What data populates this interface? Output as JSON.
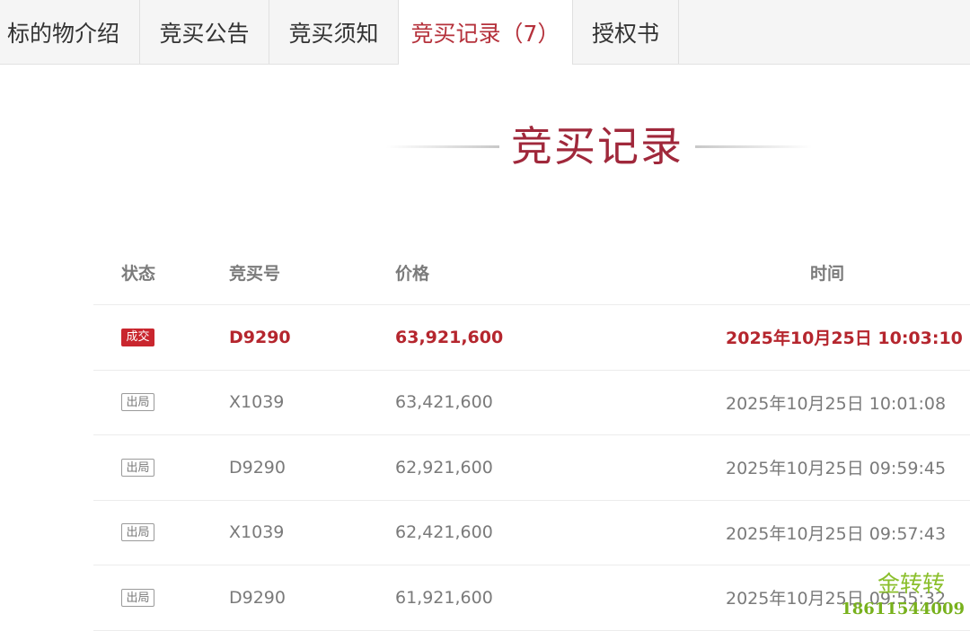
{
  "tabs": [
    {
      "label": "标的物介绍",
      "active": false
    },
    {
      "label": "竞买公告",
      "active": false
    },
    {
      "label": "竞买须知",
      "active": false
    },
    {
      "label": "竞买记录（7）",
      "active": true
    },
    {
      "label": "授权书",
      "active": false
    }
  ],
  "section": {
    "title": "竞买记录"
  },
  "table": {
    "headers": {
      "status": "状态",
      "bid_no": "竞买号",
      "price": "价格",
      "time": "时间"
    },
    "rows": [
      {
        "status": "成交",
        "bid_no": "D9290",
        "price": "63,921,600",
        "time": "2025年10月25日 10:03:10"
      },
      {
        "status": "出局",
        "bid_no": "X1039",
        "price": "63,421,600",
        "time": "2025年10月25日 10:01:08"
      },
      {
        "status": "出局",
        "bid_no": "D9290",
        "price": "62,921,600",
        "time": "2025年10月25日 09:59:45"
      },
      {
        "status": "出局",
        "bid_no": "X1039",
        "price": "62,421,600",
        "time": "2025年10月25日 09:57:43"
      },
      {
        "status": "出局",
        "bid_no": "D9290",
        "price": "61,921,600",
        "time": "2025年10月25日 09:55:32"
      }
    ]
  },
  "watermark": {
    "name": "金转转",
    "phone": "18611544009"
  },
  "colors": {
    "accent": "#b5313b",
    "deal_badge": "#c9262e",
    "watermark": "#8bbf2c"
  }
}
